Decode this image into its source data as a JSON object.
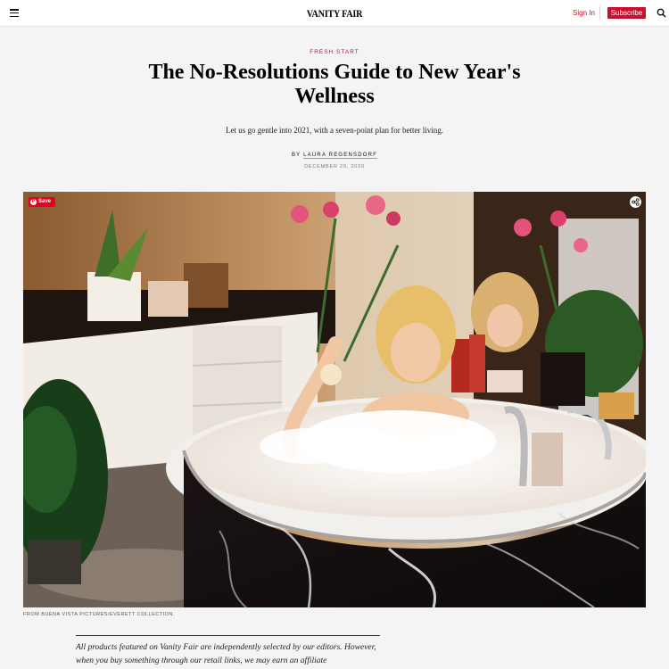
{
  "header": {
    "logo": "VANITY FAIR",
    "signin_label": "Sign In",
    "subscribe_label": "Subscribe",
    "brand_color": "#c8102e",
    "icons": [
      "hamburger-menu-icon",
      "search-icon"
    ]
  },
  "article": {
    "rubric": "FRESH START",
    "headline": "The No-Resolutions Guide to New Year's Wellness",
    "dek": "Let us go gentle into 2021, with a seven-point plan for better living.",
    "byline_prefix": "BY",
    "author": "LAURA REGENSDORF",
    "date": "DECEMBER 29, 2020"
  },
  "hero": {
    "pin_save_label": "Save",
    "pin_glyph": "P",
    "share_icon": "share-icon",
    "credit": "FROM BUENA VISTA PICTURES/EVERETT COLLECTION."
  },
  "disclaimer": {
    "text": "All products featured on Vanity Fair are independently selected by our editors. However, when you buy something through our retail links, we may earn an affiliate"
  }
}
